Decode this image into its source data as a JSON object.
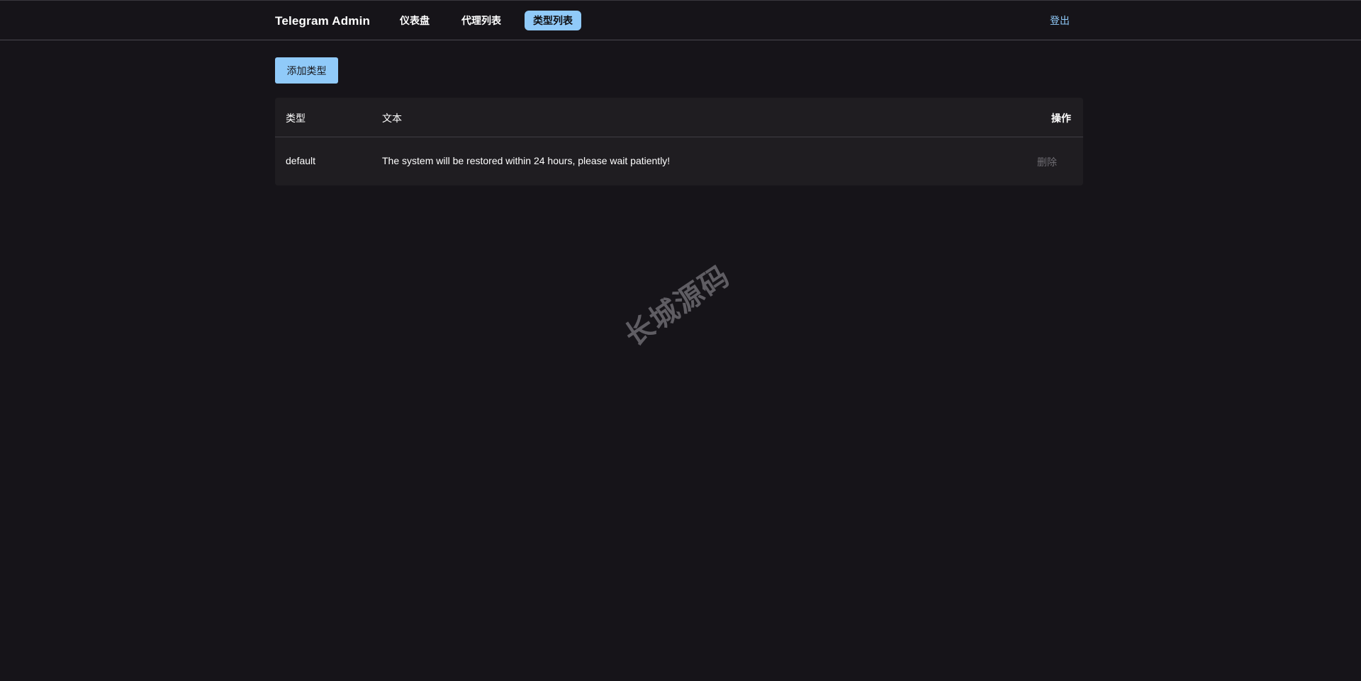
{
  "navbar": {
    "brand": "Telegram Admin",
    "items": [
      {
        "label": "仪表盘",
        "active": false
      },
      {
        "label": "代理列表",
        "active": false
      },
      {
        "label": "类型列表",
        "active": true
      }
    ],
    "logout_label": "登出"
  },
  "toolbar": {
    "add_label": "添加类型"
  },
  "table": {
    "columns": [
      "类型",
      "文本",
      "操作"
    ],
    "rows": [
      {
        "type": "default",
        "text": "The system will be restored within 24 hours, please wait patiently!",
        "action_label": "删除"
      }
    ]
  },
  "watermark": "长城源码",
  "colors": {
    "background": "#161419",
    "accent": "#90caf9",
    "card": "#1f1d21",
    "muted_action": "#6e6c72"
  }
}
